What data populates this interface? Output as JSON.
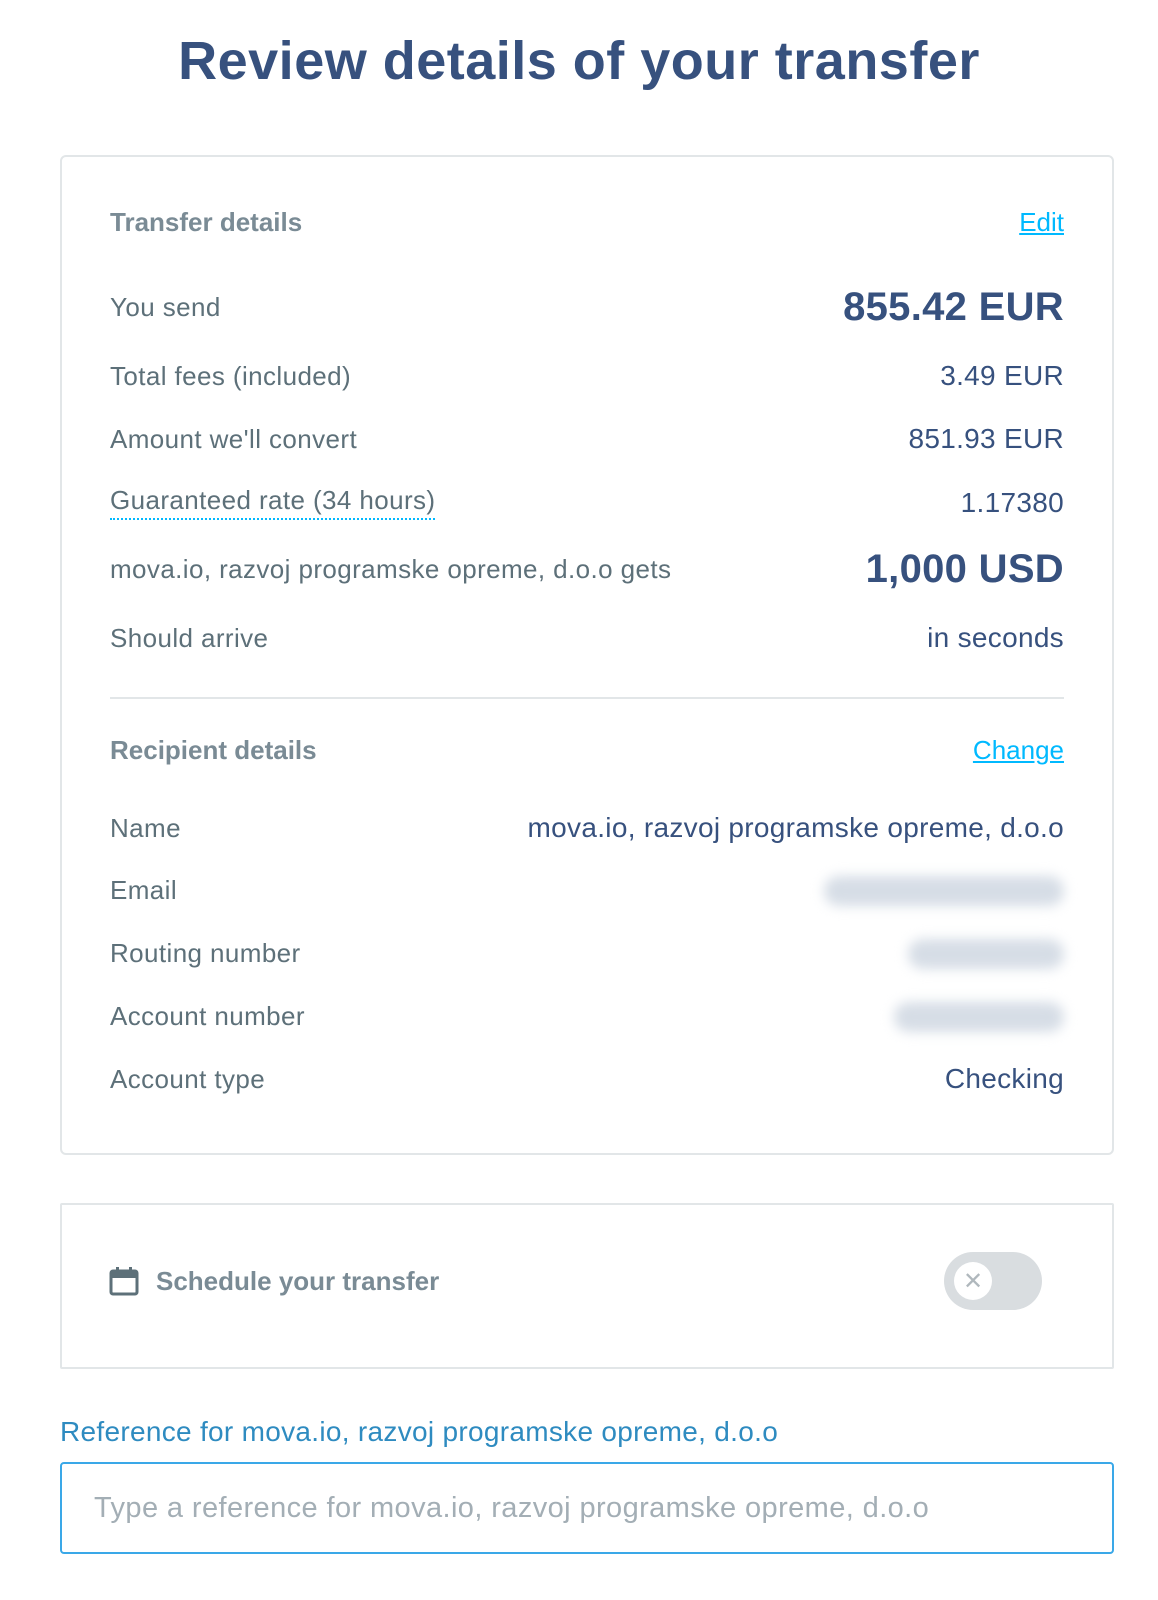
{
  "page": {
    "title": "Review details of your transfer"
  },
  "transfer": {
    "title": "Transfer details",
    "edit_label": "Edit",
    "rows": [
      {
        "label": "You send",
        "value": "855.42 EUR"
      },
      {
        "label": "Total fees (included)",
        "value": "3.49 EUR"
      },
      {
        "label": "Amount we'll convert",
        "value": "851.93 EUR"
      },
      {
        "label": "Guaranteed rate (34 hours)",
        "value": "1.17380"
      },
      {
        "label": "mova.io, razvoj programske opreme, d.o.o gets",
        "value": "1,000 USD"
      },
      {
        "label": "Should arrive",
        "value": "in seconds"
      }
    ]
  },
  "recipient": {
    "title": "Recipient details",
    "change_label": "Change",
    "rows": [
      {
        "label": "Name",
        "value": "mova.io, razvoj programske opreme, d.o.o"
      },
      {
        "label": "Email"
      },
      {
        "label": "Routing number"
      },
      {
        "label": "Account number"
      },
      {
        "label": "Account type",
        "value": "Checking"
      }
    ]
  },
  "schedule": {
    "label": "Schedule your transfer",
    "icon": "calendar-icon",
    "toggle_icon": "close-icon",
    "toggle_on": false
  },
  "reference": {
    "label": "Reference for mova.io, razvoj programske opreme, d.o.o",
    "placeholder": "Type a reference for mova.io, razvoj programske opreme, d.o.o",
    "value": ""
  },
  "colors": {
    "primary": "#37517e",
    "accent": "#00b9ff",
    "muted": "#5d7079",
    "border": "#e2e6e8"
  }
}
